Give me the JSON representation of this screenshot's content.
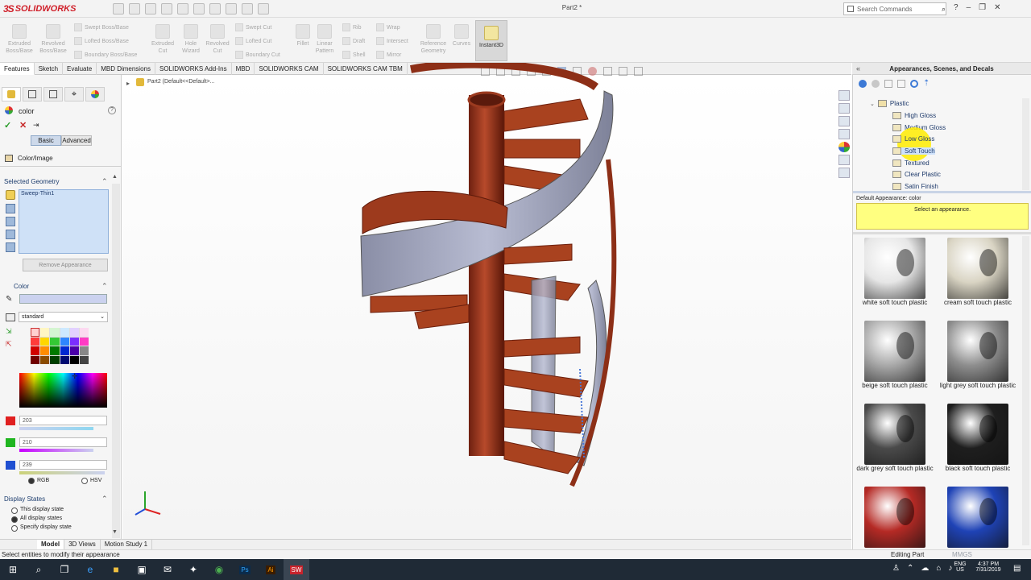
{
  "app": {
    "brand": "SOLIDWORKS",
    "brand_prefix": "3S",
    "doc_title": "Part2 *"
  },
  "search": {
    "placeholder": "Search Commands"
  },
  "window_buttons": [
    "?",
    "–",
    "❐",
    "✕"
  ],
  "commands": {
    "extruded_boss": "Extruded Boss/Base",
    "revolved_boss": "Revolved Boss/Base",
    "swept_boss": "Swept Boss/Base",
    "lofted_boss": "Lofted Boss/Base",
    "boundary_boss": "Boundary Boss/Base",
    "extruded_cut": "Extruded Cut",
    "hole_wizard": "Hole Wizard",
    "revolved_cut": "Revolved Cut",
    "swept_cut": "Swept Cut",
    "lofted_cut": "Lofted Cut",
    "boundary_cut": "Boundary Cut",
    "fillet": "Fillet",
    "linear_pattern": "Linear Pattern",
    "rib": "Rib",
    "draft": "Draft",
    "shell": "Shell",
    "wrap": "Wrap",
    "intersect": "Intersect",
    "mirror": "Mirror",
    "reference_geometry": "Reference Geometry",
    "curves": "Curves",
    "instant3d": "Instant3D"
  },
  "tabs": [
    "Features",
    "Sketch",
    "Evaluate",
    "MBD Dimensions",
    "SOLIDWORKS Add-Ins",
    "MBD",
    "SOLIDWORKS CAM",
    "SOLIDWORKS CAM TBM"
  ],
  "breadcrumb": "Part2  (Default<<Default>...",
  "property_manager": {
    "title": "color",
    "basic": "Basic",
    "advanced": "Advanced",
    "color_image": "Color/Image",
    "selected_geometry": "Selected Geometry",
    "geometry_item": "Sweep-Thin1",
    "remove_appearance": "Remove Appearance",
    "color_section": "Color",
    "palette": "standard",
    "r": "203",
    "g": "210",
    "b": "239",
    "rgb": "RGB",
    "hsv": "HSV",
    "display_states": "Display States",
    "ds_options": [
      "This display state",
      "All display states",
      "Specify display state"
    ]
  },
  "bottom_tabs": [
    "Model",
    "3D Views",
    "Motion Study 1"
  ],
  "status": {
    "left": "Select entities to modify their appearance",
    "editing": "Editing Part",
    "units": "MMGS"
  },
  "right_panel": {
    "title": "Appearances, Scenes, and Decals",
    "tree_root": "Plastic",
    "tree_items": [
      "High Gloss",
      "Medium Gloss",
      "Low Gloss",
      "Soft Touch",
      "Textured",
      "Clear Plastic",
      "Satin Finish"
    ],
    "default_appearance": "Default Appearance: color",
    "hint": "Select an appearance.",
    "swatches": [
      {
        "label": "white soft touch plastic",
        "color": "#e6e6e6"
      },
      {
        "label": "cream soft touch plastic",
        "color": "#d9d4c3"
      },
      {
        "label": "beige soft touch plastic",
        "color": "#a9a9a9"
      },
      {
        "label": "light grey soft touch plastic",
        "color": "#8e8e8e"
      },
      {
        "label": "dark grey soft touch plastic",
        "color": "#4a4a4a"
      },
      {
        "label": "black soft touch plastic",
        "color": "#1e1e1e"
      },
      {
        "label": "",
        "color": "#b52a25"
      },
      {
        "label": "",
        "color": "#1f43b6"
      }
    ]
  },
  "clock": {
    "time": "4:37 PM",
    "date": "7/31/2019",
    "lang": "ENG",
    "region": "US"
  }
}
